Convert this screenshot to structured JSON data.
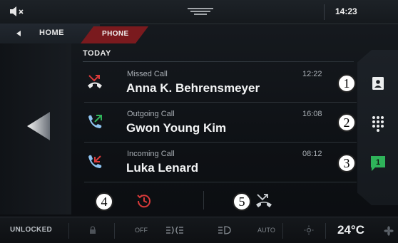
{
  "status_bar": {
    "time": "14:23"
  },
  "nav": {
    "home_label": "HOME",
    "active_tab": "PHONE"
  },
  "section": {
    "title": "TODAY"
  },
  "calls": [
    {
      "type": "Missed Call",
      "name": "Anna K. Behrensmeyer",
      "time": "12:22",
      "icon": "missed-call-icon",
      "color": "#d93a3a"
    },
    {
      "type": "Outgoing Call",
      "name": "Gwon Young Kim",
      "time": "16:08",
      "icon": "outgoing-call-icon",
      "color": "#2fb35a"
    },
    {
      "type": "Incoming Call",
      "name": "Luka Lenard",
      "time": "08:12",
      "icon": "incoming-call-icon",
      "color": "#d93a3a"
    }
  ],
  "side_actions": [
    {
      "name": "contacts",
      "icon": "contact-card-icon"
    },
    {
      "name": "keypad",
      "icon": "dialpad-icon"
    },
    {
      "name": "messages",
      "icon": "message-icon",
      "count": "1",
      "color": "#2fb35a"
    }
  ],
  "badges": [
    "1",
    "2",
    "3",
    "4",
    "5"
  ],
  "action_bar": [
    {
      "name": "recent",
      "icon": "recent-calls-icon",
      "color": "#d93a3a"
    },
    {
      "name": "missed",
      "icon": "missed-calls-filter-icon"
    }
  ],
  "bottom_bar": {
    "lock_status": "UNLOCKED",
    "fan_mode": "OFF",
    "auto_label": "AUTO",
    "temperature": "24°C"
  },
  "colors": {
    "accent_red": "#7a1a1e",
    "green": "#2fb35a",
    "red": "#d93a3a"
  }
}
